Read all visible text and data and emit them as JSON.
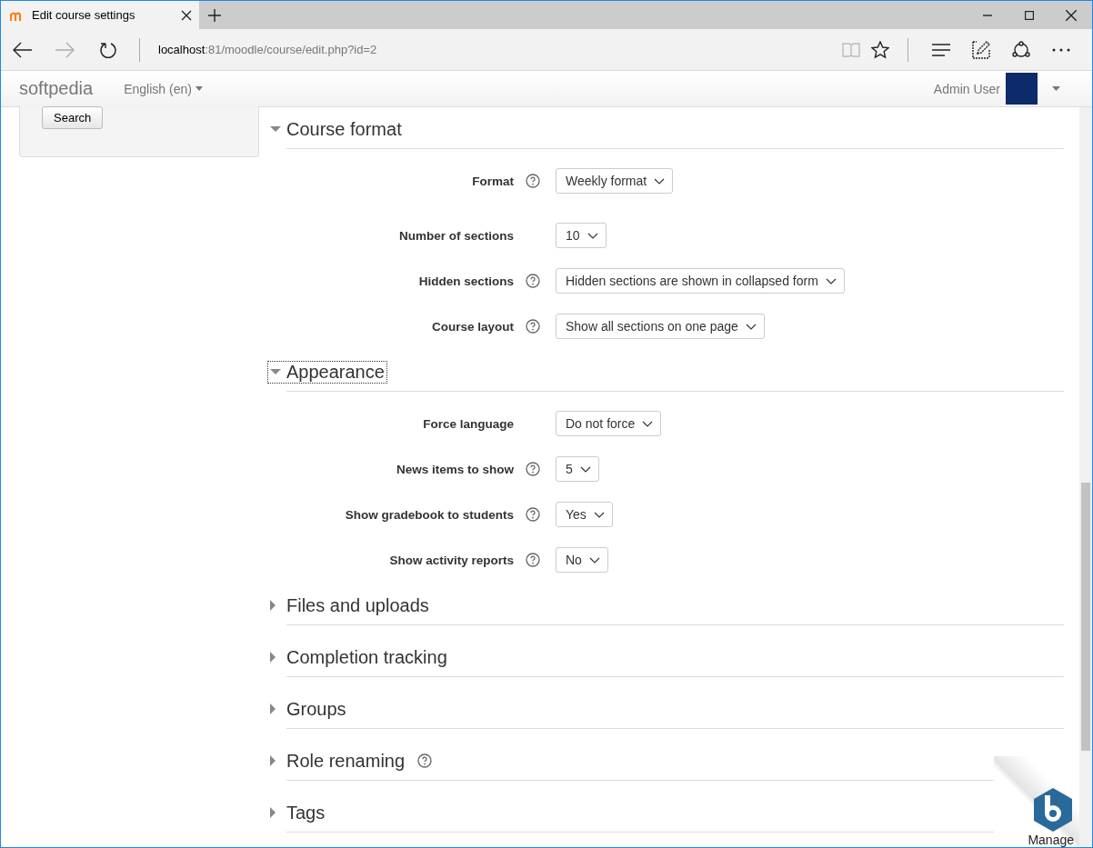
{
  "browser": {
    "tab_title": "Edit course settings",
    "url_host": "localhost",
    "url_path": ":81/moodle/course/edit.php?id=2"
  },
  "navbar": {
    "brand": "softpedia",
    "language": "English (en)",
    "user": "Admin User"
  },
  "sidebar": {
    "search_button": "Search"
  },
  "sections": [
    {
      "title": "Course format",
      "expanded": true,
      "focused": false,
      "help": false,
      "fields": [
        {
          "label": "Format",
          "help": true,
          "value": "Weekly format"
        },
        {
          "label": "Number of sections",
          "help": false,
          "value": "10"
        },
        {
          "label": "Hidden sections",
          "help": true,
          "value": "Hidden sections are shown in collapsed form"
        },
        {
          "label": "Course layout",
          "help": true,
          "value": "Show all sections on one page"
        }
      ]
    },
    {
      "title": "Appearance",
      "expanded": true,
      "focused": true,
      "help": false,
      "fields": [
        {
          "label": "Force language",
          "help": false,
          "value": "Do not force"
        },
        {
          "label": "News items to show",
          "help": true,
          "value": "5"
        },
        {
          "label": "Show gradebook to students",
          "help": true,
          "value": "Yes"
        },
        {
          "label": "Show activity reports",
          "help": true,
          "value": "No"
        }
      ]
    },
    {
      "title": "Files and uploads",
      "expanded": false,
      "focused": false,
      "help": false
    },
    {
      "title": "Completion tracking",
      "expanded": false,
      "focused": false,
      "help": false
    },
    {
      "title": "Groups",
      "expanded": false,
      "focused": false,
      "help": false
    },
    {
      "title": "Role renaming",
      "expanded": false,
      "focused": false,
      "help": true
    },
    {
      "title": "Tags",
      "expanded": false,
      "focused": false,
      "help": false
    }
  ],
  "manage_badge": {
    "label": "Manage"
  }
}
